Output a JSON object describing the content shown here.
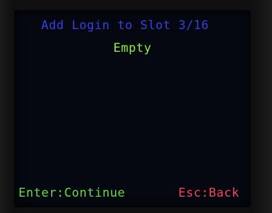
{
  "screen": {
    "title": "Add Login to Slot 3/16",
    "status": "Empty",
    "footer_left": "Enter:Continue",
    "footer_right": "Esc:Back"
  },
  "colors": {
    "title": "#3a3fe0",
    "status": "#8bf04a",
    "footer_left": "#6cd94a",
    "footer_right": "#f04a5a",
    "screen_bg": "#050810"
  }
}
